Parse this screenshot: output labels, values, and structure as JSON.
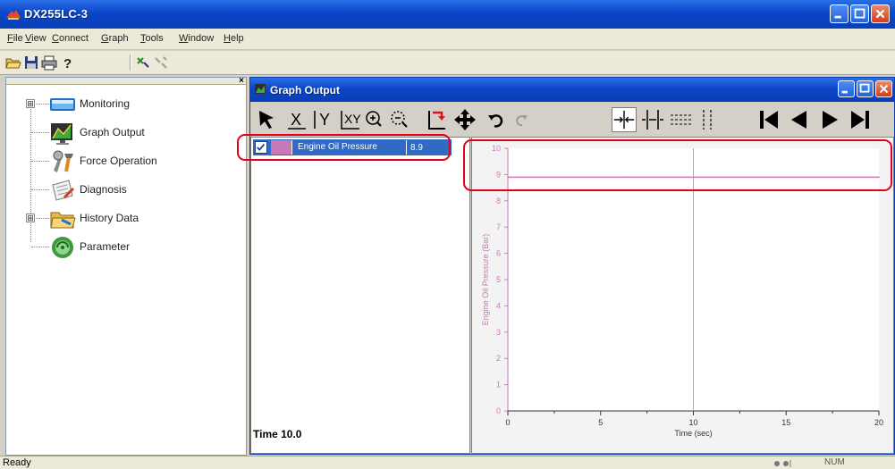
{
  "window": {
    "title": "DX255LC-3"
  },
  "menu": [
    {
      "underline": "F",
      "rest": "ile"
    },
    {
      "underline": "V",
      "rest": "iew"
    },
    {
      "underline": "C",
      "rest": "onnect"
    },
    {
      "underline": "G",
      "rest": "raph"
    },
    {
      "underline": "T",
      "rest": "ools"
    },
    {
      "underline": "W",
      "rest": "indow"
    },
    {
      "underline": "H",
      "rest": "elp"
    }
  ],
  "tree": {
    "items": [
      {
        "label": "Monitoring",
        "expandable": true,
        "expander": "⊞"
      },
      {
        "label": "Graph Output",
        "expandable": false
      },
      {
        "label": "Force Operation",
        "expandable": false
      },
      {
        "label": "Diagnosis",
        "expandable": false
      },
      {
        "label": "History Data",
        "expandable": true,
        "expander": "⊞"
      },
      {
        "label": "Parameter",
        "expandable": false
      }
    ],
    "close_glyph": "×"
  },
  "graph_window": {
    "title": "Graph Output",
    "series": {
      "checked": true,
      "name": "Engine Oil Pressure",
      "value": "8.9",
      "color": "#c77ab8"
    },
    "time_label": "Time 10.0"
  },
  "chart_data": {
    "type": "line",
    "xlabel": "Time (sec)",
    "ylabel": "Engine Oil Pressure (Bar)",
    "xlim": [
      0,
      20
    ],
    "ylim": [
      0,
      10
    ],
    "x_ticks": [
      "0",
      "5",
      "10",
      "15",
      "20"
    ],
    "y_ticks": [
      "0",
      "1",
      "2",
      "3",
      "4",
      "5",
      "6",
      "7",
      "8",
      "9",
      "10"
    ],
    "cursor_x": 10,
    "grid": false,
    "series": [
      {
        "values": [
          [
            0,
            8.9
          ],
          [
            6.5,
            8.9
          ],
          [
            20,
            8.9
          ]
        ],
        "color": "#c77ab8"
      }
    ]
  },
  "status": {
    "text": "Ready",
    "indicator": "NUM"
  },
  "colors": {
    "titlebar": "#0b46c8",
    "highlight": "#e4001b",
    "selection": "#316ac5"
  }
}
